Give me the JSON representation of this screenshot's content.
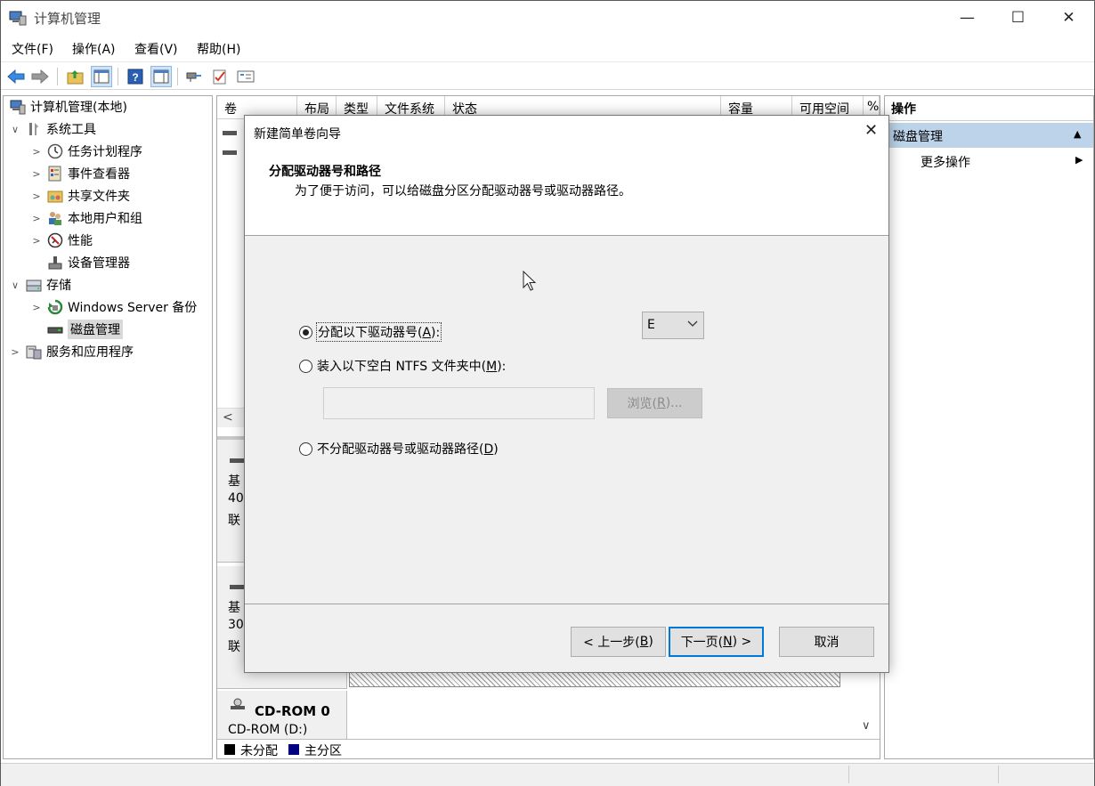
{
  "window": {
    "title": "计算机管理",
    "controls": [
      "—",
      "☐",
      "✕"
    ]
  },
  "menu": [
    "文件(F)",
    "操作(A)",
    "查看(V)",
    "帮助(H)"
  ],
  "toolbar": {
    "icons": [
      "back-arrow-icon",
      "forward-arrow-icon",
      "up-folder-icon",
      "show-hide-tree-icon",
      "help-icon",
      "properties-icon",
      "connect-icon",
      "check-icon",
      "list-icon"
    ]
  },
  "tree": {
    "items": [
      {
        "label": "计算机管理(本地)",
        "level": 0,
        "arrow": "",
        "icon": "computer-management-icon"
      },
      {
        "label": "系统工具",
        "level": 1,
        "arrow": "∨",
        "icon": "system-tools-icon"
      },
      {
        "label": "任务计划程序",
        "level": 2,
        "arrow": ">",
        "icon": "clock-icon"
      },
      {
        "label": "事件查看器",
        "level": 2,
        "arrow": ">",
        "icon": "event-viewer-icon"
      },
      {
        "label": "共享文件夹",
        "level": 2,
        "arrow": ">",
        "icon": "shared-folder-icon"
      },
      {
        "label": "本地用户和组",
        "level": 2,
        "arrow": ">",
        "icon": "users-icon"
      },
      {
        "label": "性能",
        "level": 2,
        "arrow": ">",
        "icon": "performance-icon"
      },
      {
        "label": "设备管理器",
        "level": 2,
        "arrow": "",
        "icon": "device-manager-icon"
      },
      {
        "label": "存储",
        "level": 1,
        "arrow": "∨",
        "icon": "storage-icon"
      },
      {
        "label": "Windows Server 备份",
        "level": 2,
        "arrow": ">",
        "icon": "backup-icon"
      },
      {
        "label": "磁盘管理",
        "level": 2,
        "arrow": "",
        "icon": "disk-icon",
        "selected": true
      },
      {
        "label": "服务和应用程序",
        "level": 1,
        "arrow": ">",
        "icon": "services-icon"
      }
    ]
  },
  "center": {
    "columns": [
      "卷",
      "布局",
      "类型",
      "文件系统",
      "状态",
      "容量",
      "可用空间",
      "%"
    ],
    "disk_rows": [
      {
        "line1": "基",
        "line2": "40",
        "line3": "联"
      },
      {
        "line1": "基",
        "line2": "30",
        "line3": "联"
      }
    ],
    "cdrom": {
      "name": "CD-ROM 0",
      "drive": "CD-ROM (D:)"
    },
    "legend": [
      "未分配",
      "主分区"
    ],
    "legend_colors": [
      "#000000",
      "#000080"
    ],
    "scroll_left": "<",
    "scroll_down": "∨"
  },
  "actions": {
    "header": "操作",
    "section": "磁盘管理",
    "section_arrow": "▲",
    "more": "更多操作",
    "more_arrow": "▶"
  },
  "dialog": {
    "title": "新建简单卷向导",
    "close": "✕",
    "heading": "分配驱动器号和路径",
    "subheading": "为了便于访问，可以给磁盘分区分配驱动器号或驱动器路径。",
    "option1": {
      "text": "分配以下驱动器号(",
      "key": "A",
      "tail": "):",
      "checked": true
    },
    "drive_letter": "E",
    "option2": {
      "text": "装入以下空白 NTFS 文件夹中(",
      "key": "M",
      "tail": "):",
      "checked": false
    },
    "folder_path": "",
    "browse": {
      "text": "浏览(",
      "key": "R",
      "tail": ")..."
    },
    "option3": {
      "text": "不分配驱动器号或驱动器路径(",
      "key": "D",
      "tail": ")",
      "checked": false
    },
    "back": {
      "text": "< 上一步(",
      "key": "B",
      "tail": ")"
    },
    "next": {
      "text": "下一页(",
      "key": "N",
      "tail": ") >"
    },
    "cancel": "取消"
  }
}
